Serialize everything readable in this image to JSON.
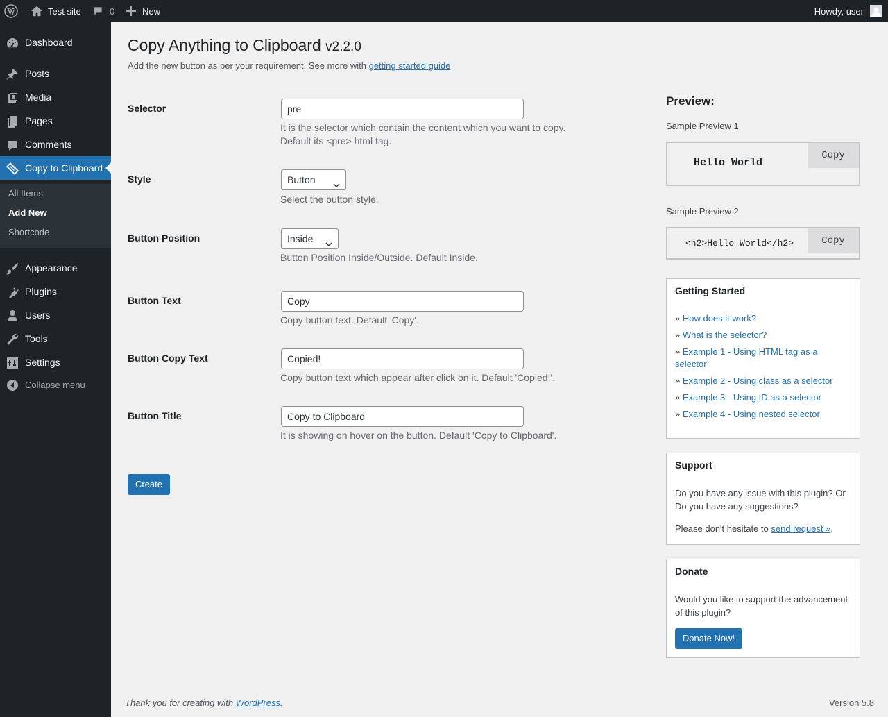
{
  "adminbar": {
    "site_name": "Test site",
    "comments_count": "0",
    "new_label": "New",
    "howdy": "Howdy, user"
  },
  "menu": {
    "items": [
      {
        "label": "Dashboard",
        "icon": "dashboard-icon"
      },
      {
        "label": "Posts",
        "icon": "pushpin-icon"
      },
      {
        "label": "Media",
        "icon": "media-icon"
      },
      {
        "label": "Pages",
        "icon": "pages-icon"
      },
      {
        "label": "Comments",
        "icon": "comment-icon"
      },
      {
        "label": "Copy to Clipboard",
        "icon": "clipboard-icon"
      },
      {
        "label": "Appearance",
        "icon": "brush-icon"
      },
      {
        "label": "Plugins",
        "icon": "plug-icon"
      },
      {
        "label": "Users",
        "icon": "user-icon"
      },
      {
        "label": "Tools",
        "icon": "wrench-icon"
      },
      {
        "label": "Settings",
        "icon": "sliders-icon"
      }
    ],
    "submenu": [
      "All Items",
      "Add New",
      "Shortcode"
    ],
    "collapse": "Collapse menu"
  },
  "page": {
    "title": "Copy Anything to Clipboard",
    "version": "v2.2.0",
    "desc_prefix": "Add the new button as per your requirement. See more with",
    "desc_link": "getting started guide"
  },
  "form": {
    "selector": {
      "label": "Selector",
      "value": "pre",
      "help1": "It is the selector which contain the content which you want to copy.",
      "help2": "Default its <pre> html tag."
    },
    "style": {
      "label": "Style",
      "value": "Button",
      "help": "Select the button style."
    },
    "position": {
      "label": "Button Position",
      "value": "Inside",
      "help": "Button Position Inside/Outside. Default Inside."
    },
    "button_text": {
      "label": "Button Text",
      "value": "Copy",
      "help": "Copy button text. Default 'Copy'."
    },
    "copy_text": {
      "label": "Button Copy Text",
      "value": "Copied!",
      "help": "Copy button text which appear after click on it. Default 'Copied!'."
    },
    "title": {
      "label": "Button Title",
      "value": "Copy to Clipboard",
      "help": "It is showing on hover on the button. Default 'Copy to Clipboard'."
    },
    "create_label": "Create"
  },
  "preview": {
    "heading": "Preview:",
    "sample1_label": "Sample Preview 1",
    "sample1_code": "Hello World",
    "sample2_label": "Sample Preview 2",
    "sample2_code": "<h2>Hello World</h2>",
    "copy_label": "Copy"
  },
  "getting_started": {
    "title": "Getting Started",
    "links": [
      "How does it work?",
      "What is the selector?",
      "Example 1 - Using HTML tag as a selector",
      "Example 2 - Using class as a selector",
      "Example 3 - Using ID as a selector",
      "Example 4 - Using nested selector"
    ]
  },
  "support": {
    "title": "Support",
    "text": "Do you have any issue with this plugin? Or Do you have any suggestions?",
    "cta_prefix": "Please don't hesitate to",
    "cta_link": "send request »",
    "cta_suffix": "."
  },
  "donate": {
    "title": "Donate",
    "text": "Would you like to support the advancement of this plugin?",
    "button": "Donate Now!"
  },
  "footer": {
    "thanks_prefix": "Thank you for creating with",
    "thanks_link": "WordPress",
    "thanks_suffix": ".",
    "version": "Version 5.8"
  }
}
